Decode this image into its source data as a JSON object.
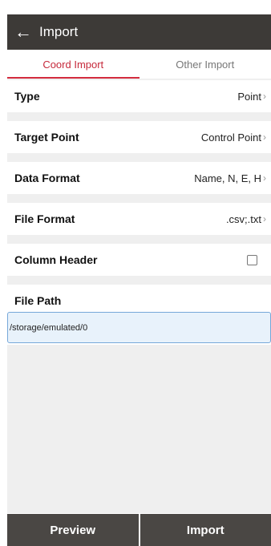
{
  "header": {
    "title": "Import"
  },
  "tabs": [
    {
      "label": "Coord Import",
      "active": true
    },
    {
      "label": "Other Import",
      "active": false
    }
  ],
  "rows": {
    "type": {
      "label": "Type",
      "value": "Point"
    },
    "target": {
      "label": "Target Point",
      "value": "Control Point"
    },
    "data_format": {
      "label": "Data Format",
      "value": "Name, N, E, H"
    },
    "file_format": {
      "label": "File Format",
      "value": ".csv;.txt"
    },
    "column_header": {
      "label": "Column Header",
      "checked": false
    }
  },
  "file_path": {
    "label": "File Path",
    "value": "/storage/emulated/0"
  },
  "buttons": {
    "preview": "Preview",
    "import": "Import"
  },
  "colors": {
    "header_bg": "#3d3a37",
    "accent": "#c6293b",
    "button_bg": "#4a4744",
    "input_bg": "#e8f2fb",
    "input_border": "#75a7d9"
  }
}
